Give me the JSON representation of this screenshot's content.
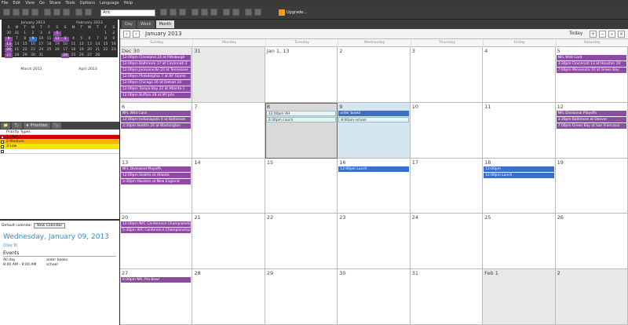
{
  "menu": [
    "File",
    "Edit",
    "View",
    "Go",
    "Share",
    "Tools",
    "Options",
    "Language",
    "Help"
  ],
  "toolbar": {
    "font": "Aric",
    "upgrade": "Upgrade..."
  },
  "mini": {
    "jan": {
      "title": "January 2013",
      "rows": [
        [
          "30",
          "31",
          "1",
          "2",
          "3",
          "4",
          "5"
        ],
        [
          "6",
          "7",
          "8",
          "9",
          "10",
          "11",
          "12"
        ],
        [
          "13",
          "14",
          "15",
          "16",
          "17",
          "18",
          "19"
        ],
        [
          "20",
          "21",
          "22",
          "23",
          "24",
          "25",
          "26"
        ],
        [
          "27",
          "28",
          "29",
          "30",
          "31",
          "",
          ""
        ]
      ]
    },
    "feb": {
      "title": "February 2013",
      "rows": [
        [
          "",
          "",
          "",
          "",
          "",
          "1",
          "2"
        ],
        [
          "3",
          "4",
          "5",
          "6",
          "7",
          "8",
          "9"
        ],
        [
          "10",
          "11",
          "12",
          "13",
          "14",
          "15",
          "16"
        ],
        [
          "17",
          "18",
          "19",
          "20",
          "21",
          "22",
          "23"
        ],
        [
          "24",
          "25",
          "26",
          "27",
          "28",
          "",
          ""
        ]
      ]
    },
    "mar": {
      "title": "March 2013"
    },
    "apr": {
      "title": "April 2013"
    },
    "dow": [
      "S",
      "M",
      "T",
      "W",
      "T",
      "F",
      "S"
    ]
  },
  "lefttabs": [
    "📁",
    "🏷",
    "★ Priorities",
    "📎"
  ],
  "priorities": {
    "header": "Priority Types",
    "items": [
      {
        "label": "1 High",
        "color": "#d40000"
      },
      {
        "label": "2 Medium",
        "color": "#f4b400"
      },
      {
        "label": "3 Low",
        "color": "#f3e600"
      },
      {
        "label": "",
        "color": "#ffffff"
      }
    ]
  },
  "bottom": {
    "default_label": "Default calendar",
    "default_value": "New Calendar",
    "date": "Wednesday, January 09, 2013",
    "date_badge": "(Day 9)",
    "events_header": "Events",
    "events": [
      {
        "time": "All day",
        "title": "order books"
      },
      {
        "time": "8:00 AM - 9:00 AM",
        "title": "school"
      }
    ]
  },
  "views": {
    "tabs": [
      "Day",
      "Week",
      "Month"
    ],
    "title": "January 2013",
    "today": "Today"
  },
  "days": [
    "Sunday",
    "Monday",
    "Tuesday",
    "Wednesday",
    "Thursday",
    "Friday",
    "Saturday"
  ],
  "weeks": [
    [
      {
        "n": "Dec 30",
        "cls": "other",
        "ev": [
          {
            "t": "12:00pm Cleveland 24 at Pittsburgh",
            "c": "purple"
          },
          {
            "t": "12:00pm Baltimore 17 at Cincinnati 2",
            "c": "purple"
          },
          {
            "t": "12:00pm Jacksonville 20 at Tennessee",
            "c": "purple"
          },
          {
            "t": "12:00pm Philadelphia 7 at NY Giants",
            "c": "purple"
          },
          {
            "t": "12:00pm Chicago 26 at Detroit 24",
            "c": "purple"
          },
          {
            "t": "12:00pm Tampa Bay 22 at Atlanta 1",
            "c": "purple"
          },
          {
            "t": "12:00pm Buffalo 28 at NY Jets",
            "c": "purple"
          }
        ]
      },
      {
        "n": "31",
        "cls": "other",
        "ev": []
      },
      {
        "n": "Jan 1, 13",
        "cls": "",
        "ev": []
      },
      {
        "n": "2",
        "cls": "",
        "ev": []
      },
      {
        "n": "3",
        "cls": "",
        "ev": []
      },
      {
        "n": "4",
        "cls": "",
        "ev": []
      },
      {
        "n": "5",
        "cls": "",
        "ev": [
          {
            "t": "NFL Wild Card",
            "c": "purple"
          },
          {
            "t": "3:30pm Cincinnati 13 at Houston 19",
            "c": "purple"
          },
          {
            "t": "7:00pm Minnesota 10 at Green Bay",
            "c": "purple"
          }
        ]
      }
    ],
    [
      {
        "n": "6",
        "cls": "",
        "ev": [
          {
            "t": "NFL Wild Card",
            "c": "purple"
          },
          {
            "t": "12:00pm Indianapolis 9 at Baltimore",
            "c": "purple"
          },
          {
            "t": "3:30pm Seattle 24 at Washington",
            "c": "purple"
          }
        ]
      },
      {
        "n": "7",
        "cls": "",
        "ev": []
      },
      {
        "n": "8",
        "cls": "today",
        "ev": [
          {
            "t": "12:00pm AH",
            "c": "cyan"
          },
          {
            "t": "6:30pm couch",
            "c": "cyan"
          }
        ]
      },
      {
        "n": "9",
        "cls": "selday",
        "ev": [
          {
            "t": "order books",
            "c": "blue"
          },
          {
            "t": "8:00am school",
            "c": "cyan"
          }
        ]
      },
      {
        "n": "10",
        "cls": "",
        "ev": []
      },
      {
        "n": "11",
        "cls": "",
        "ev": []
      },
      {
        "n": "12",
        "cls": "",
        "ev": [
          {
            "t": "NFL Divisional Playoffs",
            "c": "purple"
          },
          {
            "t": "3:30pm Baltimore at Denver",
            "c": "purple"
          },
          {
            "t": "7:00pm Green Bay at San Francisco",
            "c": "purple"
          }
        ]
      }
    ],
    [
      {
        "n": "13",
        "cls": "",
        "ev": [
          {
            "t": "NFL Divisional Playoffs",
            "c": "purple"
          },
          {
            "t": "12:00pm Seattle at Atlanta",
            "c": "purple"
          },
          {
            "t": "3:30pm Houston at New England",
            "c": "purple"
          }
        ]
      },
      {
        "n": "14",
        "cls": "",
        "ev": []
      },
      {
        "n": "15",
        "cls": "",
        "ev": []
      },
      {
        "n": "16",
        "cls": "",
        "ev": [
          {
            "t": "12:00pm Lunch",
            "c": "blue"
          }
        ]
      },
      {
        "n": "17",
        "cls": "",
        "ev": []
      },
      {
        "n": "18",
        "cls": "",
        "ev": [
          {
            "t": "12:00pm",
            "c": "blue"
          },
          {
            "t": "12:00pm Lunch",
            "c": "blue"
          }
        ]
      },
      {
        "n": "19",
        "cls": "",
        "ev": []
      }
    ],
    [
      {
        "n": "20",
        "cls": "",
        "ev": [
          {
            "t": "12:00pm NFC Conference Championship",
            "c": "purple"
          },
          {
            "t": "5:30pm AFC Conference Championship",
            "c": "purple"
          }
        ]
      },
      {
        "n": "21",
        "cls": "",
        "ev": []
      },
      {
        "n": "22",
        "cls": "",
        "ev": []
      },
      {
        "n": "23",
        "cls": "",
        "ev": []
      },
      {
        "n": "24",
        "cls": "",
        "ev": []
      },
      {
        "n": "25",
        "cls": "",
        "ev": []
      },
      {
        "n": "26",
        "cls": "",
        "ev": []
      }
    ],
    [
      {
        "n": "27",
        "cls": "",
        "ev": [
          {
            "t": "6:00pm NFL Pro Bowl",
            "c": "purple"
          }
        ]
      },
      {
        "n": "28",
        "cls": "",
        "ev": []
      },
      {
        "n": "29",
        "cls": "",
        "ev": []
      },
      {
        "n": "30",
        "cls": "",
        "ev": []
      },
      {
        "n": "31",
        "cls": "",
        "ev": []
      },
      {
        "n": "Feb 1",
        "cls": "other",
        "ev": []
      },
      {
        "n": "2",
        "cls": "other",
        "ev": []
      }
    ]
  ]
}
